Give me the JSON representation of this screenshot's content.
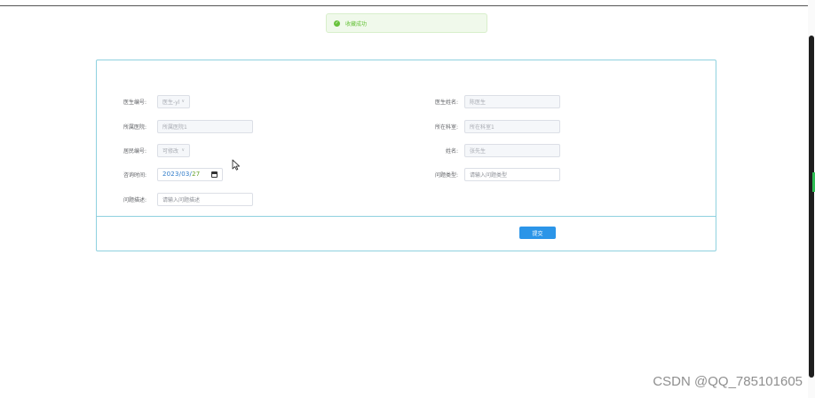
{
  "toast": {
    "message": "收藏成功",
    "icon": "check-circle-icon"
  },
  "form": {
    "doctor_id": {
      "label": "医生编号:",
      "value": "医生-yl"
    },
    "doctor_name": {
      "label": "医生姓名:",
      "value": "陈医生"
    },
    "hospital": {
      "label": "所属医院:",
      "value": "所属医院1"
    },
    "department": {
      "label": "所在科室:",
      "value": "所在科室1"
    },
    "resident_id": {
      "label": "居民编号:",
      "value": "可修改"
    },
    "name": {
      "label": "姓名:",
      "value": "张先生"
    },
    "consult_time": {
      "label": "咨询时间:",
      "year": "2023",
      "month": "03",
      "day": "27",
      "sep": "/"
    },
    "question_type": {
      "label": "问题类型:",
      "placeholder": "请输入问题类型"
    },
    "question_desc": {
      "label": "问题描述:",
      "placeholder": "请输入问题描述"
    }
  },
  "actions": {
    "submit": "提交"
  },
  "watermark": "CSDN @QQ_785101605",
  "colors": {
    "accent": "#2b95e8",
    "success": "#67c23a",
    "panel_border": "#8fd1df"
  }
}
